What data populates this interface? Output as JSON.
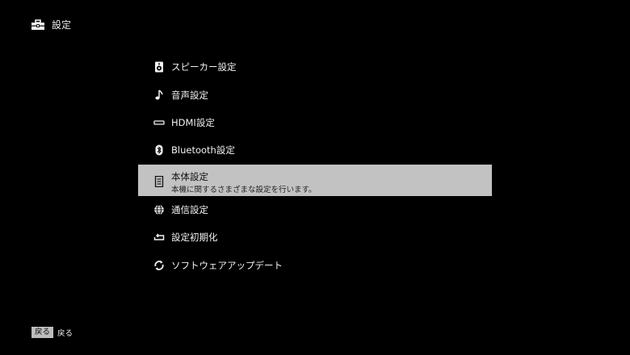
{
  "header": {
    "title": "設定",
    "icon": "toolbox-icon"
  },
  "menu": {
    "items": [
      {
        "label": "スピーカー設定",
        "icon": "speaker-icon"
      },
      {
        "label": "音声設定",
        "icon": "music-note-icon"
      },
      {
        "label": "HDMI設定",
        "icon": "hdmi-icon"
      },
      {
        "label": "Bluetooth設定",
        "icon": "bluetooth-icon"
      },
      {
        "label": "本体設定",
        "description": "本機に関するさまざまな設定を行います。",
        "icon": "device-icon",
        "selected": true
      },
      {
        "label": "通信設定",
        "icon": "globe-icon"
      },
      {
        "label": "設定初期化",
        "icon": "reset-icon"
      },
      {
        "label": "ソフトウェアアップデート",
        "icon": "update-icon"
      }
    ]
  },
  "footer": {
    "key": "戻る",
    "label": "戻る"
  },
  "colors": {
    "background": "#000000",
    "selected_bg": "#c2c2c2",
    "text": "#f2f2f2"
  }
}
